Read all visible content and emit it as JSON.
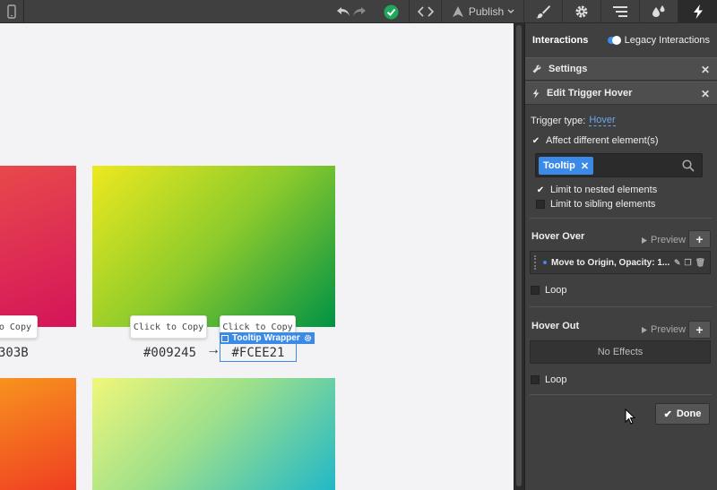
{
  "toolbar": {
    "publish_label": "Publish",
    "icons": [
      "device-icon",
      "undo-icon",
      "redo-icon",
      "check-status-icon",
      "code-icon",
      "publish-icon",
      "brush-icon",
      "gear-icon",
      "navigator-icon",
      "drops-icon",
      "lightning-icon"
    ]
  },
  "canvas": {
    "copy_label_1": "Click to Copy",
    "copy_label_2": "Click to Copy",
    "copy_label_partial": "o Copy",
    "hex_partial": "303B",
    "hex_1": "#009245",
    "hex_selected": "#FCEE21",
    "wrapper_label": "Tooltip Wrapper",
    "colors": {
      "accent": "#3b8ae8"
    }
  },
  "panel": {
    "title": "Interactions",
    "legacy_label": "Legacy Interactions",
    "settings_label": "Settings",
    "trigger_title": "Edit Trigger Hover",
    "trigger_type_label": "Trigger type:",
    "trigger_type_value": "Hover",
    "affect_label": "Affect different element(s)",
    "tag_label": "Tooltip",
    "limit_nested_label": "Limit to nested elements",
    "limit_sibling_label": "Limit to sibling elements",
    "hover_over_title": "Hover Over",
    "preview_label": "Preview",
    "action_label": "Move to Origin, Opacity: 1...",
    "loop_label": "Loop",
    "hover_out_title": "Hover Out",
    "preview_label_2": "Preview",
    "no_effects_label": "No Effects",
    "loop_label_2": "Loop",
    "done_label": "Done"
  }
}
